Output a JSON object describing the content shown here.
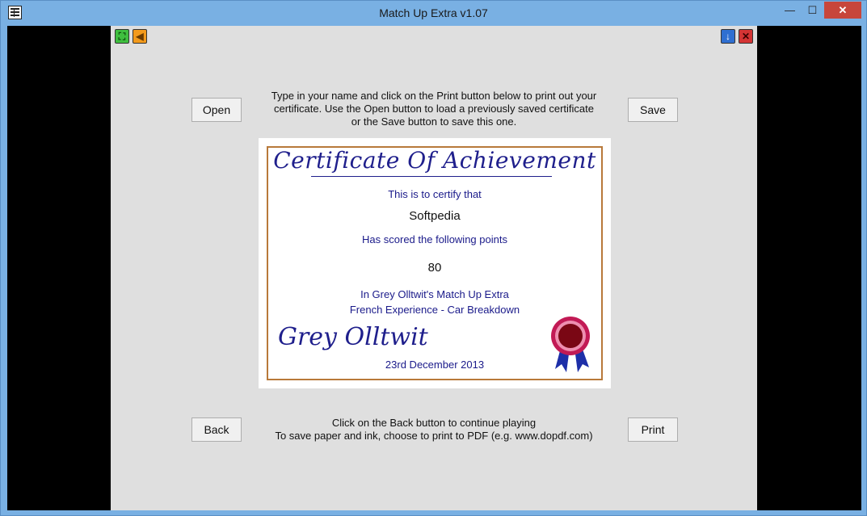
{
  "window": {
    "title": "Match Up Extra v1.07",
    "minimize_glyph": "—",
    "maximize_glyph": "☐",
    "close_glyph": "✕"
  },
  "toolbar": {
    "fullscreen_glyph": "⛶",
    "sound_glyph": "◀",
    "minimize_glyph": "↓",
    "exit_glyph": "✕"
  },
  "buttons": {
    "open": "Open",
    "save": "Save",
    "back": "Back",
    "print": "Print"
  },
  "instructions": [
    "Type in your name and click on the Print button below to print out your",
    "certificate. Use the Open button to load a previously saved certificate",
    "or the Save button to save this one."
  ],
  "footer": [
    "Click on the Back button to continue playing",
    "To save paper and ink, choose to print to PDF (e.g. www.dopdf.com)"
  ],
  "certificate": {
    "title": "Certificate Of Achievement",
    "certify_text": "This is to certify that",
    "name": "Softpedia",
    "scored_text": "Has scored the following points",
    "points": "80",
    "game_text": "In Grey Olltwit's Match Up Extra",
    "mode_text": "French Experience - Car Breakdown",
    "signature": "Grey Olltwit",
    "date": "23rd December 2013"
  },
  "colors": {
    "stage": "#dfdfdf",
    "cert_text": "#1a1a8a",
    "cert_border": "#b8793a",
    "seal_red": "#8b0a1a",
    "ribbon_blue": "#1d2fa8"
  }
}
